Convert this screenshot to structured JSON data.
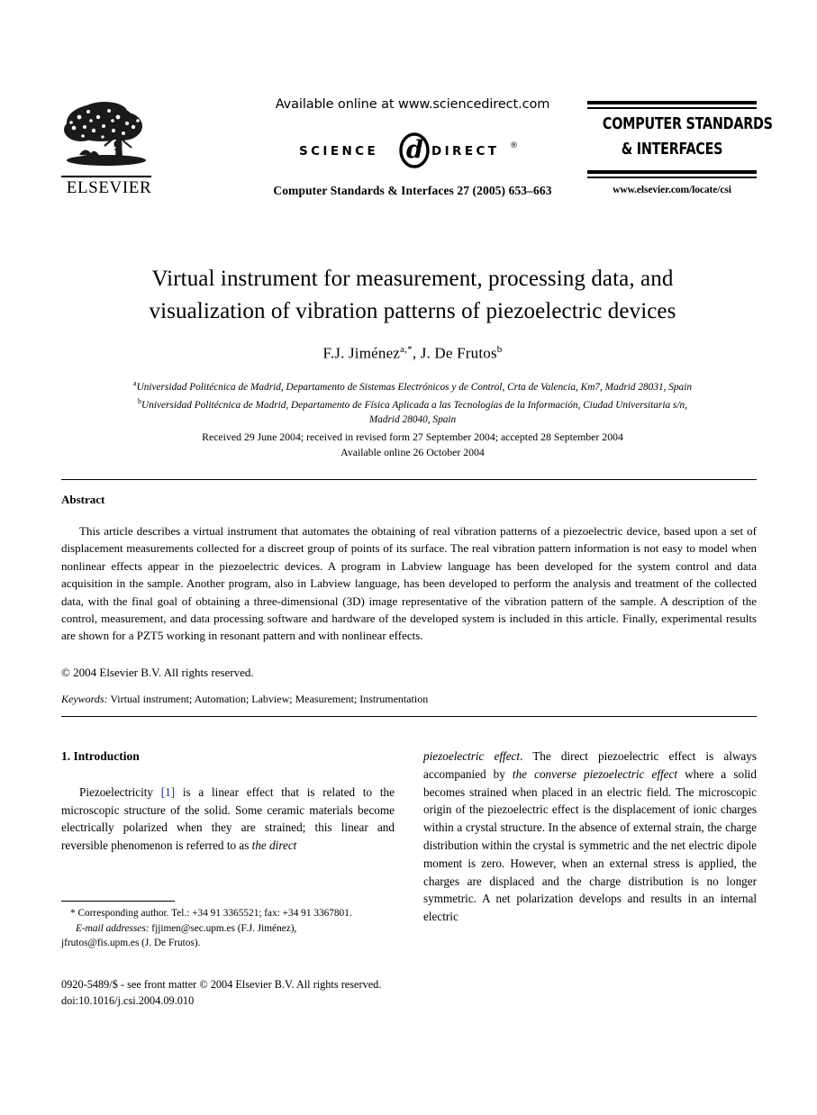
{
  "masthead": {
    "publisher_name": "ELSEVIER",
    "available_online": "Available online at www.sciencedirect.com",
    "sciencedirect_science": "SCIENCE",
    "sciencedirect_direct": "DIRECT",
    "sciencedirect_tm": "®",
    "journal_citation": "Computer Standards & Interfaces 27 (2005) 653–663",
    "journal_logo_line1": "COMPUTER STANDARDS",
    "journal_logo_line2": "& INTERFACES",
    "journal_url": "www.elsevier.com/locate/csi"
  },
  "title_block": {
    "title_line1": "Virtual instrument for measurement, processing data, and",
    "title_line2": "visualization of vibration patterns of piezoelectric devices",
    "author1_name": "F.J. Jiménez",
    "author1_sup": "a,*",
    "author_separator": ", ",
    "author2_name": "J. De Frutos",
    "author2_sup": "b"
  },
  "affiliations": {
    "aff_a_sup": "a",
    "aff_a": "Universidad Politécnica de Madrid, Departamento de Sistemas Electrónicos y de Control, Crta de Valencia, Km7, Madrid 28031, Spain",
    "aff_b_sup": "b",
    "aff_b_line1": "Universidad Politécnica de Madrid, Departamento de Física Aplicada a las Tecnologías de la Información, Ciudad Universitaria s/n,",
    "aff_b_line2": "Madrid 28040, Spain"
  },
  "dates": {
    "received": "Received 29 June 2004; received in revised form 27 September 2004; accepted 28 September 2004",
    "available_online": "Available online 26 October 2004"
  },
  "abstract": {
    "heading": "Abstract",
    "body": "This article describes a virtual instrument that automates the obtaining of real vibration patterns of a piezoelectric device, based upon a set of displacement measurements collected for a discreet group of points of its surface. The real vibration pattern information is not easy to model when nonlinear effects appear in the piezoelectric devices. A program in Labview language has been developed for the system control and data acquisition in the sample. Another program, also in Labview language, has been developed to perform the analysis and treatment of the collected data, with the final goal of obtaining a three-dimensional (3D) image representative of the vibration pattern of the sample. A description of the control, measurement, and data processing software and hardware of the developed system is included in this article. Finally, experimental results are shown for a PZT5 working in resonant pattern and with nonlinear effects.",
    "copyright": "© 2004 Elsevier B.V. All rights reserved."
  },
  "keywords": {
    "label": "Keywords:",
    "value": " Virtual instrument; Automation; Labview; Measurement; Instrumentation"
  },
  "introduction": {
    "heading": "1. Introduction",
    "left_text_before_cite": "Piezoelectricity ",
    "citation": "[1]",
    "left_text_after_cite": " is a linear effect that is related to the microscopic structure of the solid. Some ceramic materials become electrically polarized when they are strained; this linear and reversible phenomenon is referred to as ",
    "left_italic_tail": "the direct",
    "right_italic_head": "piezoelectric effect",
    "right_text_1": ". The direct piezoelectric effect is always accompanied by ",
    "right_italic_2": "the converse piezoelectric effect",
    "right_text_2": " where a solid becomes strained when placed in an electric field. The microscopic origin of the piezoelectric effect is the displacement of ionic charges within a crystal structure. In the absence of external strain, the charge distribution within the crystal is symmetric and the net electric dipole moment is zero. However, when an external stress is applied, the charges are displaced and the charge distribution is no longer symmetric. A net polarization develops and results in an internal electric"
  },
  "footnote": {
    "marker": "*",
    "corresponding": " Corresponding author. Tel.: +34 91 3365521; fax: +34 91 3367801.",
    "email_label": "E-mail addresses:",
    "email_line1": " fjjimen@sec.upm.es (F.J. Jiménez),",
    "email_line2": "jfrutos@fis.upm.es (J. De Frutos)."
  },
  "copyright_footer": {
    "line1": "0920-5489/$ - see front matter © 2004 Elsevier B.V. All rights reserved.",
    "line2": "doi:10.1016/j.csi.2004.09.010"
  },
  "colors": {
    "text": "#000000",
    "citation_link": "#2222aa",
    "page_background": "#ffffff"
  }
}
